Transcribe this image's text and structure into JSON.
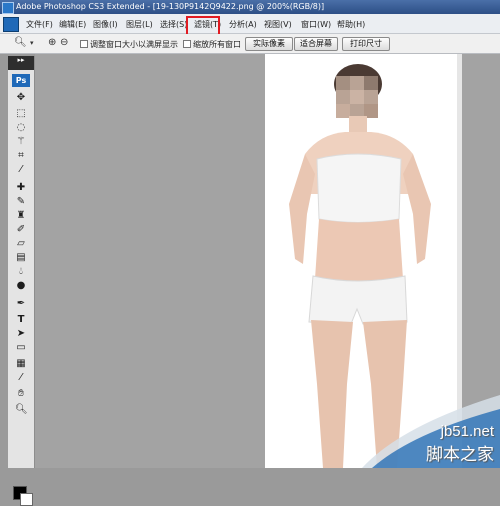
{
  "window": {
    "title": "Adobe Photoshop CS3 Extended - [19-130P9142Q9422.png @ 200%(RGB/8)]"
  },
  "menu": {
    "items": [
      {
        "label": "文件(F)"
      },
      {
        "label": "编辑(E)"
      },
      {
        "label": "图像(I)"
      },
      {
        "label": "图层(L)"
      },
      {
        "label": "选择(S)"
      },
      {
        "label": "滤镜(T)"
      },
      {
        "label": "分析(A)"
      },
      {
        "label": "视图(V)"
      },
      {
        "label": "窗口(W)"
      },
      {
        "label": "帮助(H)"
      }
    ],
    "highlighted": "滤镜(T)",
    "highlight_color": "#e11b22"
  },
  "options": {
    "resize_windows_label": "调整窗口大小以满屏显示",
    "zoom_all_label": "缩放所有窗口",
    "actual_pixels_label": "实际像素",
    "fit_screen_label": "适合屏幕",
    "print_size_label": "打印尺寸"
  },
  "toolbox": {
    "header": "▸▸",
    "logo": "Ps"
  },
  "watermark": {
    "site": "jb51.net",
    "brand": "脚本之家"
  },
  "colors": {
    "foreground": "#000000",
    "background": "#ffffff",
    "accent": "#2d4f86"
  }
}
